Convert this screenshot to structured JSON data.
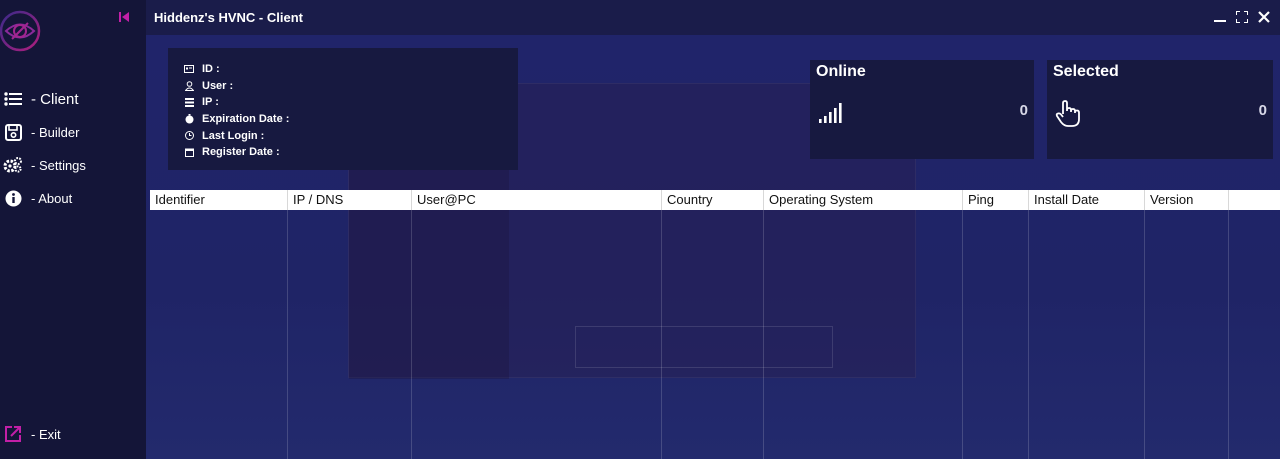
{
  "sidebar": {
    "items": [
      {
        "label": "- Client",
        "icon": "list-icon"
      },
      {
        "label": "- Builder",
        "icon": "save-icon"
      },
      {
        "label": "- Settings",
        "icon": "gears-icon"
      },
      {
        "label": "- About",
        "icon": "info-icon"
      }
    ],
    "exit_label": "- Exit"
  },
  "window": {
    "title": "Hiddenz's HVNC - Client"
  },
  "info": {
    "rows": [
      {
        "label": "ID :",
        "icon": "id-card-icon"
      },
      {
        "label": "User :",
        "icon": "user-icon"
      },
      {
        "label": "IP :",
        "icon": "server-icon"
      },
      {
        "label": "Expiration Date :",
        "icon": "stopwatch-icon"
      },
      {
        "label": "Last Login :",
        "icon": "clock-icon"
      },
      {
        "label": "Register Date :",
        "icon": "calendar-icon"
      }
    ]
  },
  "cards": {
    "online": {
      "title": "Online",
      "value": "0",
      "icon": "signal-icon"
    },
    "selected": {
      "title": "Selected",
      "value": "0",
      "icon": "hand-pointer-icon"
    }
  },
  "table": {
    "columns": [
      "Identifier",
      "IP / DNS",
      "User@PC",
      "Country",
      "Operating System",
      "Ping",
      "Install Date",
      "Version"
    ]
  },
  "colors": {
    "accent": "#c21fa7",
    "background": "#1f2466",
    "sidebar": "#141538",
    "panel": "#171940"
  }
}
